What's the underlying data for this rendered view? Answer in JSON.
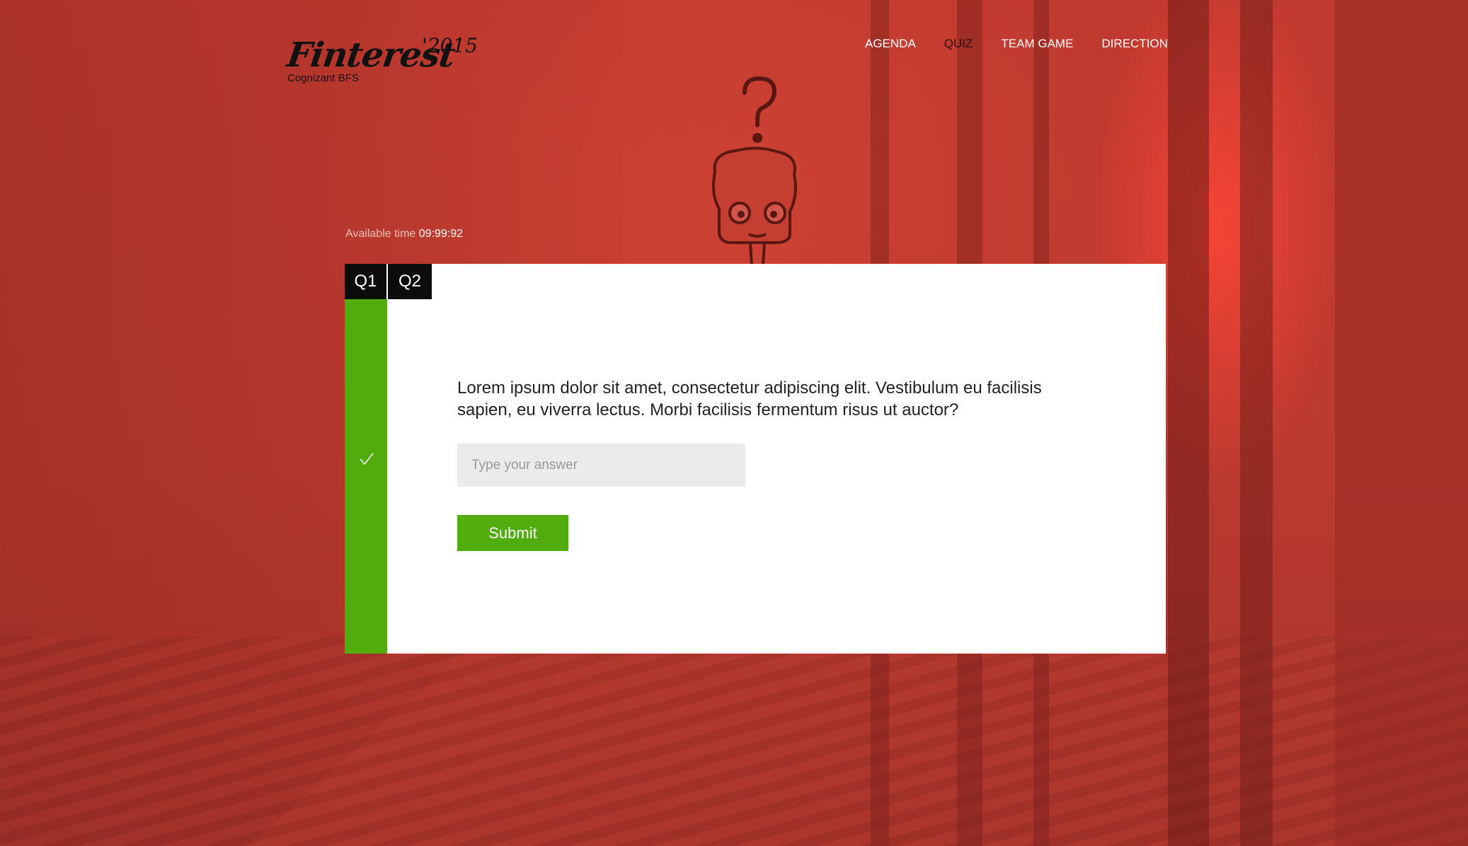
{
  "brand": {
    "name": "Finterest",
    "year": "'2015",
    "subtitle": "Cognizant BFS"
  },
  "nav": {
    "items": [
      {
        "label": "AGENDA",
        "active": false
      },
      {
        "label": "QUIZ",
        "active": true
      },
      {
        "label": "TEAM GAME",
        "active": false
      },
      {
        "label": "DIRECTION",
        "active": false
      }
    ]
  },
  "timer": {
    "label": "Available time",
    "value": "09:99:92"
  },
  "tabs": [
    {
      "label": "Q1"
    },
    {
      "label": "Q2"
    }
  ],
  "question": {
    "text": "Lorem ipsum dolor sit amet, consectetur adipiscing elit. Vestibulum eu facilisis sapien, eu viverra lectus. Morbi facilisis fermentum risus ut auctor?",
    "answer_value": "",
    "answer_placeholder": "Type your answer",
    "submit_label": "Submit",
    "status": "answered"
  },
  "colors": {
    "background": "#b8352b",
    "accent_green": "#50ad0d",
    "tab_black": "#0c0c0c",
    "input_bg": "#ebebeb"
  }
}
